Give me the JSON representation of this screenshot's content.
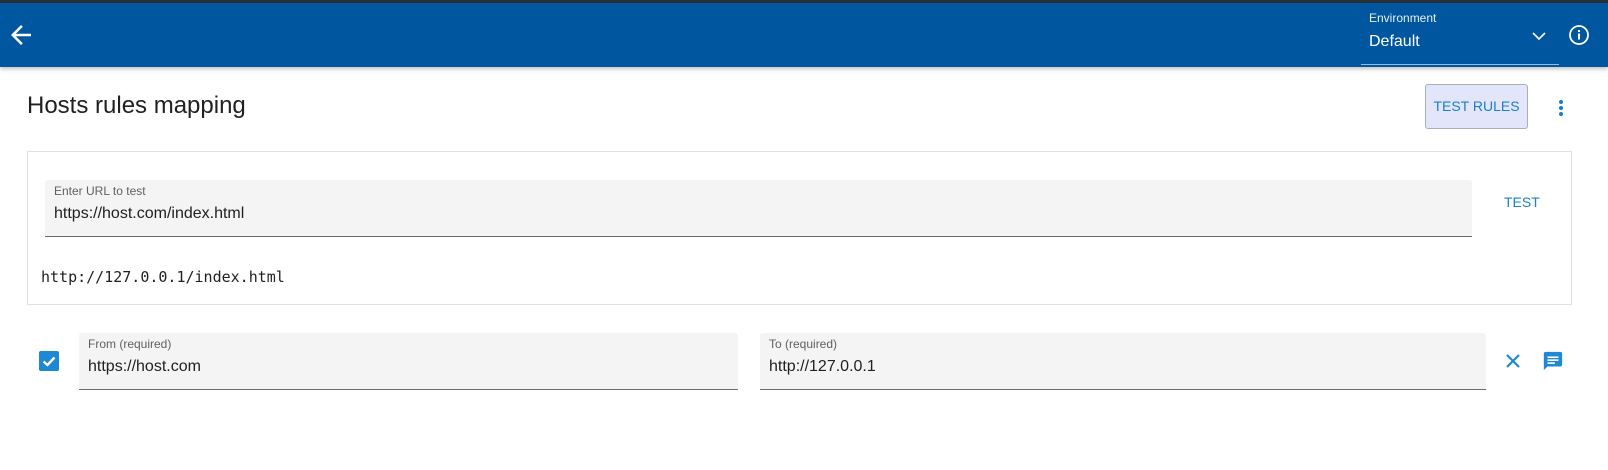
{
  "appbar": {
    "environment_label": "Environment",
    "environment_value": "Default",
    "back_icon": "arrow-back-icon",
    "dropdown_icon": "chevron-down-icon",
    "info_icon": "info-icon",
    "bg_color": "#00579f"
  },
  "page": {
    "title": "Hosts rules mapping",
    "test_rules_label": "TEST RULES",
    "menu_icon": "more-vert-icon"
  },
  "tester": {
    "url_label": "Enter URL to test",
    "url_value": "https://host.com/index.html",
    "test_label": "TEST",
    "result": "http://127.0.0.1/index.html"
  },
  "rules": [
    {
      "enabled": true,
      "from_label": "From (required)",
      "from_value": "https://host.com",
      "to_label": "To (required)",
      "to_value": "http://127.0.0.1",
      "remove_icon": "close-icon",
      "comment_icon": "comment-icon"
    }
  ],
  "colors": {
    "accent": "#1a7fc8",
    "checkbox": "#1e88d2",
    "test_rules_bg": "#e3e6fb"
  }
}
